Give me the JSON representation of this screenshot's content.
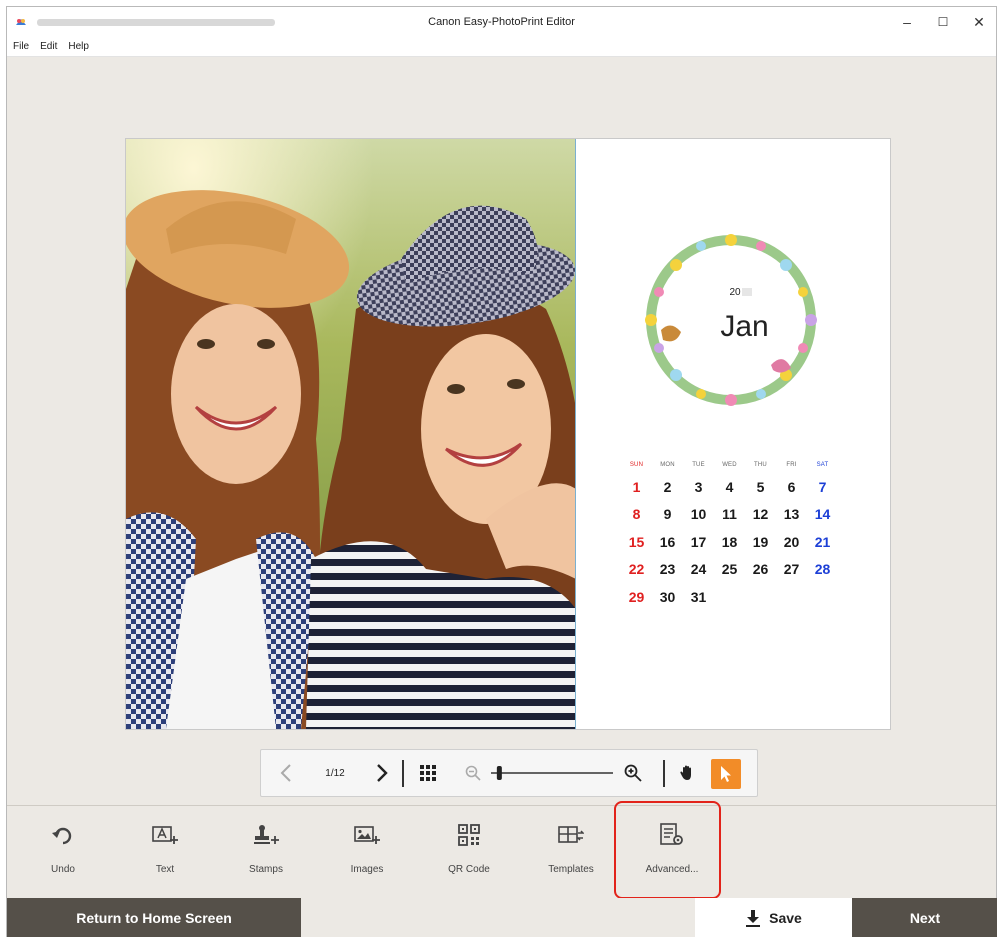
{
  "window": {
    "title": "Canon Easy-PhotoPrint Editor",
    "minimize": "–",
    "maximize": "☐",
    "close": "✕"
  },
  "menu": [
    "File",
    "Edit",
    "Help"
  ],
  "calendar": {
    "year": "20",
    "month": "Jan",
    "weekdays": [
      "SUN",
      "MON",
      "TUE",
      "WED",
      "THU",
      "FRI",
      "SAT"
    ],
    "weeks": [
      [
        "1",
        "2",
        "3",
        "4",
        "5",
        "6",
        "7"
      ],
      [
        "8",
        "9",
        "10",
        "11",
        "12",
        "13",
        "14"
      ],
      [
        "15",
        "16",
        "17",
        "18",
        "19",
        "20",
        "21"
      ],
      [
        "22",
        "23",
        "24",
        "25",
        "26",
        "27",
        "28"
      ],
      [
        "29",
        "30",
        "31",
        "",
        "",
        "",
        ""
      ]
    ],
    "colors": {
      "sunday": "#e02020",
      "saturday": "#1c3fd6"
    }
  },
  "zoombar": {
    "page_indicator": "1/12",
    "zoom_level_fraction": 0.05
  },
  "tools": [
    {
      "label": "Undo",
      "icon": "undo-icon"
    },
    {
      "label": "Text",
      "icon": "text-icon"
    },
    {
      "label": "Stamps",
      "icon": "stamp-icon"
    },
    {
      "label": "Images",
      "icon": "image-add-icon"
    },
    {
      "label": "QR Code",
      "icon": "qr-code-icon"
    },
    {
      "label": "Templates",
      "icon": "templates-icon"
    },
    {
      "label": "Advanced...",
      "icon": "advanced-settings-icon"
    }
  ],
  "footer": {
    "home": "Return to Home Screen",
    "save": "Save",
    "next": "Next"
  },
  "colors": {
    "accent": "#f28c28",
    "dark_button": "#555049",
    "highlight": "#e2231a"
  }
}
